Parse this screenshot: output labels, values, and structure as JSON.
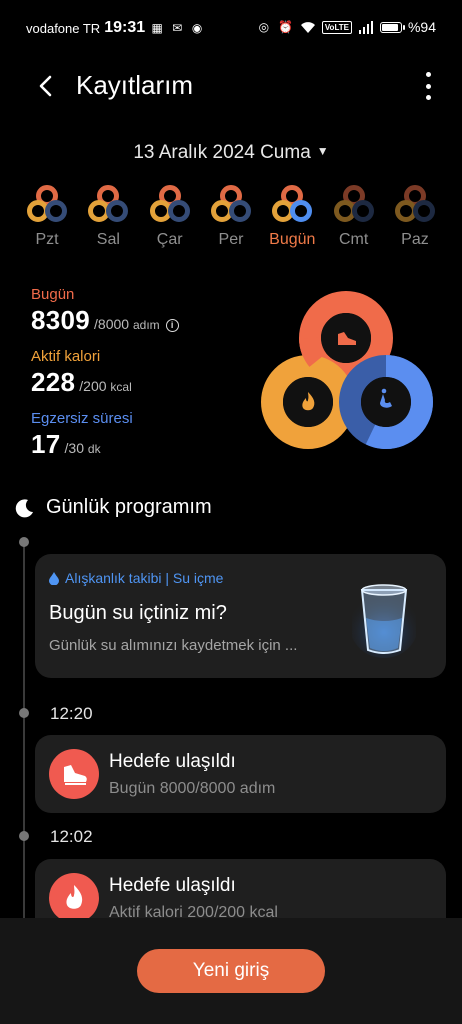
{
  "status_bar": {
    "carrier": "vodafone TR",
    "time": "19:31",
    "volte": "VoLTE",
    "battery": "%94",
    "battery_level": 0.94
  },
  "header": {
    "title": "Kayıtlarım"
  },
  "date_selector": {
    "label": "13 Aralık 2024 Cuma"
  },
  "week": [
    {
      "label": "Pzt"
    },
    {
      "label": "Sal"
    },
    {
      "label": "Çar"
    },
    {
      "label": "Per"
    },
    {
      "label": "Bugün"
    },
    {
      "label": "Cmt"
    },
    {
      "label": "Paz"
    }
  ],
  "stats": {
    "steps": {
      "label": "Bugün",
      "value": "8309",
      "goal": "/8000",
      "unit": "adım",
      "color": "#f06b4a"
    },
    "calories": {
      "label": "Aktif kalori",
      "value": "228",
      "goal": "/200",
      "unit": "kcal",
      "color": "#f0a23b"
    },
    "exercise": {
      "label": "Egzersiz süresi",
      "value": "17",
      "goal": "/30",
      "unit": "dk",
      "color": "#5b8ef0"
    }
  },
  "rings": {
    "steps_progress": 1.0,
    "calories_progress": 1.0,
    "exercise_progress": 0.57
  },
  "program": {
    "title": "Günlük programım",
    "reminder": {
      "tag": "Alışkanlık takibi | Su içme",
      "title": "Bugün su içtiniz mi?",
      "desc": "Günlük su alımınızı kaydetmek için ..."
    },
    "entries": [
      {
        "time": "12:20",
        "title": "Hedefe ulaşıldı",
        "subtitle": "Bugün 8000/8000 adım"
      },
      {
        "time": "12:02",
        "title": "Hedefe ulaşıldı",
        "subtitle": "Aktif kalori 200/200 kcal"
      }
    ]
  },
  "new_entry_button": "Yeni giriş",
  "colors": {
    "accent": "#e46a44",
    "card": "#1f1f1f",
    "blue": "#4f95f3"
  }
}
